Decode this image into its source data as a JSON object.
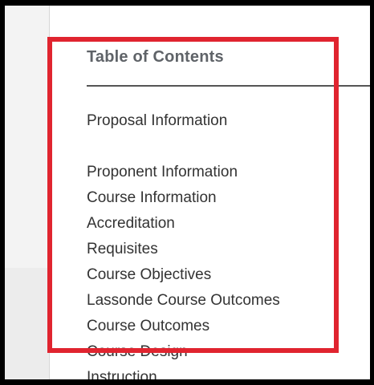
{
  "toc": {
    "title": "Table of Contents",
    "items": [
      {
        "label": "Proposal Information"
      },
      {
        "label": "Proponent Information"
      },
      {
        "label": "Course Information"
      },
      {
        "label": "Accreditation"
      },
      {
        "label": "Requisites"
      },
      {
        "label": "Course Objectives"
      },
      {
        "label": "Lassonde Course Outcomes"
      },
      {
        "label": "Course Outcomes"
      },
      {
        "label": "Course Design"
      },
      {
        "label": "Instruction"
      }
    ]
  },
  "colors": {
    "highlight_border": "#e0242f",
    "heading_text": "#5f6368",
    "item_text": "#333333",
    "panel_background": "#ffffff",
    "side_background": "#f3f3f3",
    "outer_frame": "#000000"
  }
}
